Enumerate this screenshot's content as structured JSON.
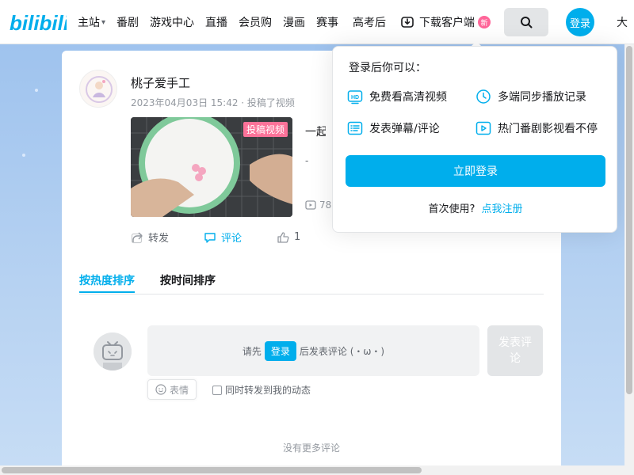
{
  "nav": {
    "logo_text": "bilibili",
    "items": [
      "主站",
      "番剧",
      "游戏中心",
      "直播",
      "会员购",
      "漫画",
      "赛事",
      "高考后"
    ],
    "download_label": "下载客户端",
    "download_badge": "新",
    "login_label": "登录",
    "cut_text": "大"
  },
  "post": {
    "username": "桃子爱手工",
    "meta": "2023年04月03日 15:42 · 投稿了视频",
    "video": {
      "tag": "投稿视频",
      "title": "一起来",
      "desc": "-",
      "plays": "78"
    },
    "actions": {
      "forward": "转发",
      "comment": "评论",
      "like": "1"
    }
  },
  "comments": {
    "tabs": [
      "按热度排序",
      "按时间排序"
    ],
    "reply_prefix": "请先",
    "reply_login": "登录",
    "reply_suffix": "后发表评论 (・ω・)",
    "post_button": "发表评论",
    "emoji_label": "表情",
    "forward_label": "同时转发到我的动态",
    "no_more": "没有更多评论"
  },
  "popover": {
    "title": "登录后你可以：",
    "perks": [
      "免费看高清视频",
      "多端同步播放记录",
      "发表弹幕/评论",
      "热门番剧影视看不停"
    ],
    "login_button": "立即登录",
    "footer_prefix": "首次使用?",
    "footer_link": "点我注册"
  },
  "colors": {
    "accent": "#00aeec",
    "pink": "#fb7299"
  }
}
